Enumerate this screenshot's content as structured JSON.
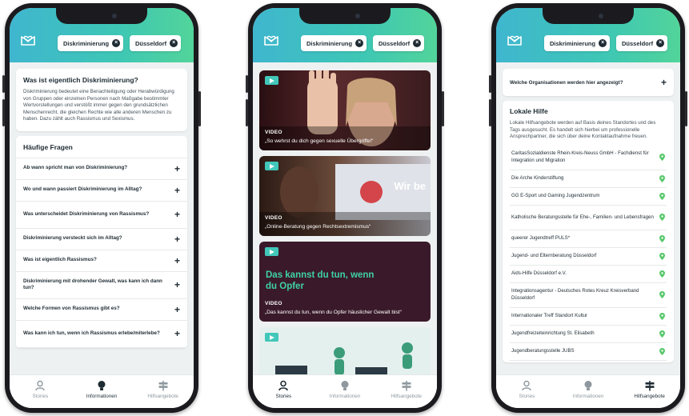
{
  "filters": {
    "chip1": "Diskriminierung",
    "chip2": "Düsseldorf"
  },
  "tabs": {
    "stories": "Stories",
    "info": "Informationen",
    "help": "Hilfsangebote"
  },
  "icons": {
    "logo": "heart-mail-logo",
    "stories": "person-icon",
    "info": "lightbulb-icon",
    "help": "signpost-icon",
    "close": "close-icon",
    "pin": "location-pin-icon",
    "play": "play-icon"
  },
  "colors": {
    "accent": "#3ec7b4",
    "pin": "#58c86b",
    "text": "#1e2b33"
  },
  "screen1": {
    "intro_title": "Was ist eigentlich Diskriminierung?",
    "intro_text": "Diskriminierung bedeutet eine Benachteiligung oder Herabwürdigung von Gruppen oder einzelnen Personen nach Maßgabe bestimmter Wertvorstellungen und verstößt immer gegen den grundsätzlichen Menschenrecht, die gleichen Rechte wie alle anderen Menschen zu haben. Dazu zählt auch Rassismus und Sexismus.",
    "faq_title": "Häufige Fragen",
    "faq": [
      {
        "q": "Ab wann spricht man von Diskriminierung?"
      },
      {
        "q": "Wo und wann passiert Diskriminierung im Alltag?"
      },
      {
        "q": "Was unterscheidet Diskriminierung von Rassismus?"
      },
      {
        "q": "Diskriminierung versteckt sich im Alltag?"
      },
      {
        "q": "Was ist eigentlich Rassismus?"
      },
      {
        "q": "Diskriminierung mit drohender Gewalt, was kann ich dann tun?"
      },
      {
        "q": "Welche Formen von Rassismus gibt es?"
      },
      {
        "q": "Was kann ich tun, wenn ich Rassismus erlebe/miterlebe?"
      }
    ]
  },
  "screen2": {
    "videos": [
      {
        "label": "VIDEO",
        "title": "„So wehrst du dich gegen sexuelle Übergriffe!“"
      },
      {
        "label": "VIDEO",
        "title": "„Online-Beratung gegen Rechtsextremismus“",
        "overlay": "Wir be"
      },
      {
        "label": "VIDEO",
        "title": "„Das kannst du tun, wenn du Opfer häuslicher Gewalt bist“",
        "overlay": "Das kannst du tun, wenn du Opfer"
      },
      {
        "label": "",
        "title": ""
      }
    ]
  },
  "screen3": {
    "question": "Welche Organisationen werden hier angezeigt?",
    "section_title": "Lokale Hilfe",
    "section_text": "Lokale Hilfsangebote werden auf Basis deines Standortes und des Tags ausgesucht. Es handelt sich hierbei um professionelle Ansprechpartner, die sich über deine Kontaktaufnahme freuen.",
    "orgs": [
      "CaritasSozialdienste Rhein-Kreis-Neuss GmbH - Fachdienst für Integration und Migration",
      "Die Arche Kinderstiftung",
      "GG E-Sport und Gaming Jugendzentrum",
      "Katholische Beratungsstelle für Ehe-, Familien- und Lebensfragen",
      "queerer Jugendtreff PULS*",
      "Jugend- und Elternberatung Düsseldorf",
      "Aids-Hilfe Düsseldorf e.V.",
      "Integrationsagentur - Deutsches Rotes Kreuz Kreisverband Düsseldorf",
      "Internationaler Treff Standort Kultur",
      "Jugendfreizeiteinrichtung St. Elisabeth",
      "Jugendberatungsstelle JUBS"
    ]
  }
}
